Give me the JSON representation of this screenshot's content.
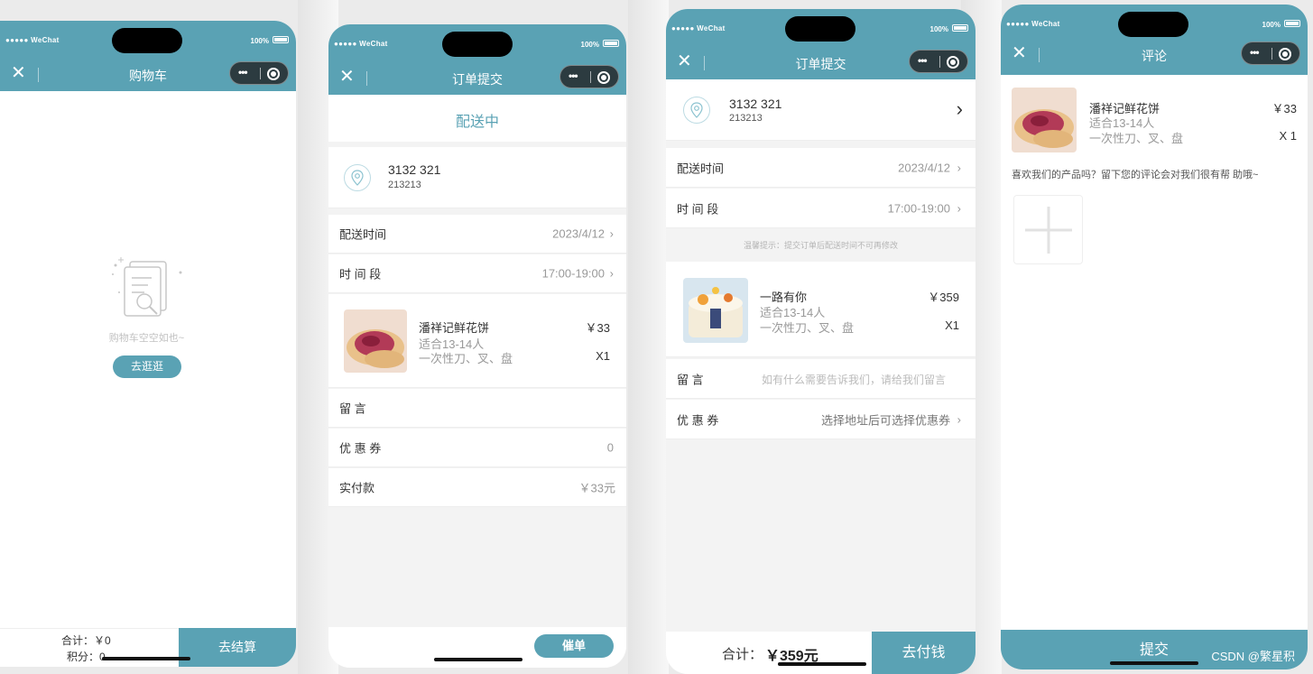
{
  "common": {
    "carrier": "●●●●● WeChat",
    "battery_text": "100%",
    "close_glyph": "✕",
    "capsule_dots": "•••",
    "icons": [
      "close-icon",
      "more-dots-icon",
      "target-icon",
      "location-pin-icon",
      "chevron-right-icon",
      "plus-icon",
      "empty-document-icon"
    ],
    "accent_color": "#5aa2b4"
  },
  "cart": {
    "title": "购物车",
    "empty_text": "购物车空空如也~",
    "browse_button": "去逛逛",
    "total_label": "合计：￥0",
    "points_label": "积分：0",
    "checkout_button": "去结算"
  },
  "order1": {
    "title": "订单提交",
    "status": "配送中",
    "address": {
      "name": "3132 321",
      "detail": "213213"
    },
    "delivery_time": {
      "label": "配送时间",
      "value": "2023/4/12"
    },
    "time_slot": {
      "label": "时 间 段",
      "value": "17:00-19:00"
    },
    "product": {
      "name": "潘祥记鲜花饼",
      "spec": "适合13-14人",
      "extra": "一次性刀、叉、盘",
      "price": "￥33",
      "qty": "X1"
    },
    "message": {
      "label": "留 言"
    },
    "coupon": {
      "label": "优 惠 券",
      "value": "0"
    },
    "paid": {
      "label": "实付款",
      "value": "￥33元"
    },
    "urge_button": "催单"
  },
  "order2": {
    "title": "订单提交",
    "address": {
      "name": "3132 321",
      "detail": "213213"
    },
    "delivery_time": {
      "label": "配送时间",
      "value": "2023/4/12"
    },
    "time_slot": {
      "label": "时 间 段",
      "value": "17:00-19:00"
    },
    "tip": "温馨提示：提交订单后配送时间不可再修改",
    "product": {
      "name": "一路有你",
      "spec": "适合13-14人",
      "extra": "一次性刀、叉、盘",
      "price": "￥359",
      "qty": "X1"
    },
    "message": {
      "label": "留 言",
      "placeholder": "如有什么需要告诉我们，请给我们留言"
    },
    "coupon": {
      "label": "优 惠 券",
      "value": "选择地址后可选择优惠券"
    },
    "total_label": "合计：",
    "total_value": "￥359元",
    "pay_button": "去付钱"
  },
  "review": {
    "title": "评论",
    "product": {
      "name": "潘祥记鲜花饼",
      "spec": "适合13-14人",
      "extra": "一次性刀、叉、盘",
      "price": "￥33",
      "qty": "X 1"
    },
    "prompt": "喜欢我们的产品吗？留下您的评论会对我们很有帮 助哦~",
    "submit_button": "提交",
    "watermark": "CSDN @繁星积"
  }
}
